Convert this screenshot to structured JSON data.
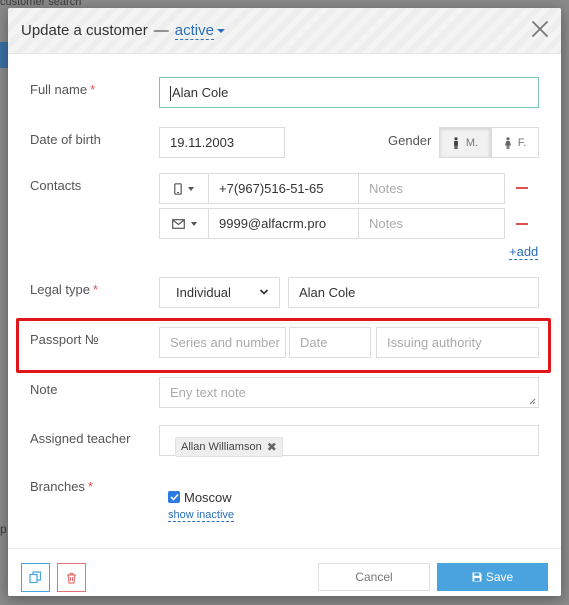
{
  "background": {
    "top_text": "customer search",
    "left_letter": "p"
  },
  "modal": {
    "title": "Update a customer",
    "separator": "—",
    "status": "active",
    "close_icon": "close-icon"
  },
  "form": {
    "full_name": {
      "label": "Full name",
      "required_mark": "*",
      "value": "Alan Cole"
    },
    "date_of_birth": {
      "label": "Date of birth",
      "value": "19.11.2003"
    },
    "gender": {
      "label": "Gender",
      "male": "M.",
      "female": "F.",
      "selected": "M."
    },
    "contacts": {
      "label": "Contacts",
      "rows": [
        {
          "type_icon": "phone-icon",
          "value": "+7(967)516-51-65",
          "notes_placeholder": "Notes"
        },
        {
          "type_icon": "email-icon",
          "value": "9999@alfacrm.pro",
          "notes_placeholder": "Notes"
        }
      ],
      "add_label": "+add"
    },
    "legal_type": {
      "label": "Legal type",
      "required_mark": "*",
      "selected": "Individual",
      "name_value": "Alan Cole"
    },
    "passport": {
      "label": "Passport №",
      "series_placeholder": "Series and number",
      "date_placeholder": "Date",
      "authority_placeholder": "Issuing authority"
    },
    "note": {
      "label": "Note",
      "placeholder": "Eny text note"
    },
    "assigned_teacher": {
      "label": "Assigned teacher",
      "tags": [
        "Allan Williamson"
      ]
    },
    "branches": {
      "label": "Branches",
      "required_mark": "*",
      "checked_item": "Moscow",
      "show_inactive": "show inactive"
    }
  },
  "footer": {
    "cancel_label": "Cancel",
    "save_label": "Save"
  },
  "colors": {
    "accent_blue": "#4aa3df",
    "link_blue": "#2a6fb8",
    "required_red": "#e05252",
    "highlight_red": "#e0161a",
    "focus_border": "#7cc6b0"
  }
}
